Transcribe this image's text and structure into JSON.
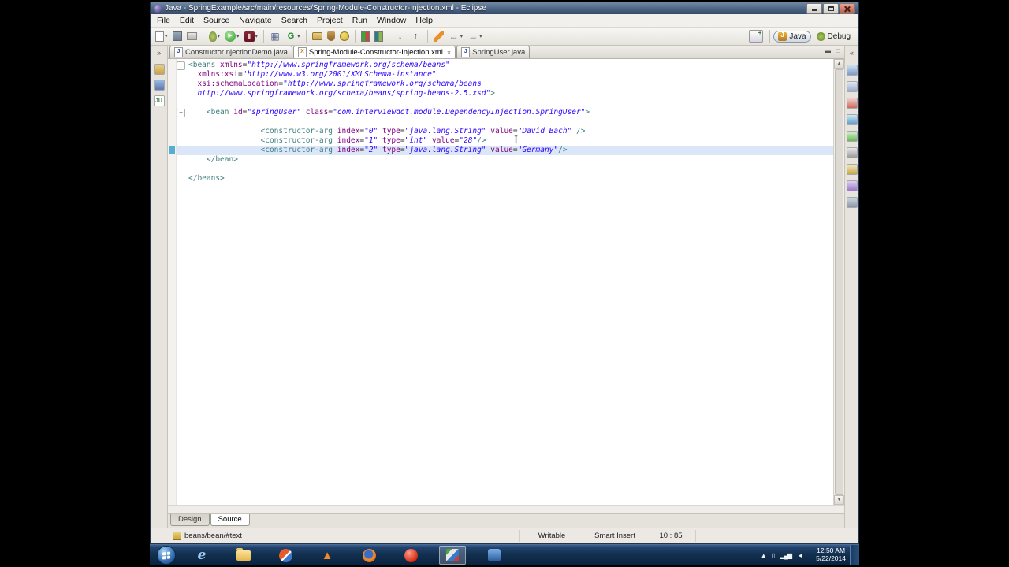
{
  "window": {
    "title": "Java - SpringExample/src/main/resources/Spring-Module-Constructor-Injection.xml - Eclipse",
    "controls": [
      {
        "name": "minimize"
      },
      {
        "name": "maximize"
      },
      {
        "name": "close"
      }
    ]
  },
  "menu": {
    "items": [
      "File",
      "Edit",
      "Source",
      "Navigate",
      "Search",
      "Project",
      "Run",
      "Window",
      "Help"
    ]
  },
  "toolbar": {
    "buttons": [
      {
        "name": "new-wizard",
        "icon": "page",
        "dropdown": true
      },
      {
        "name": "save",
        "icon": "save"
      },
      {
        "name": "print",
        "icon": "print"
      },
      {
        "sep": true
      },
      {
        "name": "debug",
        "icon": "debug",
        "dropdown": true
      },
      {
        "name": "run",
        "icon": "run",
        "dropdown": true
      },
      {
        "name": "coverage",
        "icon": "coverage",
        "dropdown": true
      },
      {
        "sep": true
      },
      {
        "name": "java-ee-table",
        "icon": "grid"
      },
      {
        "name": "run-server",
        "icon": "g",
        "dropdown": true
      },
      {
        "sep": true
      },
      {
        "name": "new-java-project",
        "icon": "project"
      },
      {
        "name": "open-type",
        "icon": "jar"
      },
      {
        "name": "search",
        "icon": "search"
      },
      {
        "sep": true
      },
      {
        "name": "junit",
        "icon": "junit"
      },
      {
        "name": "coverage-report",
        "icon": "junit2"
      },
      {
        "sep": true
      },
      {
        "name": "next-annotation",
        "icon": "down"
      },
      {
        "name": "prev-annotation",
        "icon": "up"
      },
      {
        "sep": true
      },
      {
        "name": "last-edit-location",
        "icon": "edit"
      },
      {
        "name": "back",
        "icon": "back",
        "dropdown": true
      },
      {
        "name": "forward",
        "icon": "forward",
        "dropdown": true
      }
    ]
  },
  "perspectives": {
    "items": [
      {
        "label": "Java",
        "active": true
      },
      {
        "label": "Debug",
        "active": false
      }
    ]
  },
  "editor": {
    "tabs": [
      {
        "label": "ConstructorInjectionDemo.java",
        "kind": "java",
        "active": false
      },
      {
        "label": "Spring-Module-Constructor-Injection.xml",
        "kind": "xml",
        "active": true
      },
      {
        "label": "SpringUser.java",
        "kind": "java",
        "active": false
      }
    ],
    "lines": [
      {
        "n": 1,
        "fold": true,
        "tokens": [
          [
            "t",
            "<beans"
          ],
          [
            "a",
            " xmlns"
          ],
          [
            "e",
            "="
          ],
          [
            "v",
            "\"http://www.springframework.org/schema/beans\""
          ]
        ]
      },
      {
        "n": 2,
        "tokens": [
          [
            "p",
            "  "
          ],
          [
            "a",
            "xmlns:xsi"
          ],
          [
            "e",
            "="
          ],
          [
            "v",
            "\"http://www.w3.org/2001/XMLSchema-instance\""
          ]
        ]
      },
      {
        "n": 3,
        "tokens": [
          [
            "p",
            "  "
          ],
          [
            "a",
            "xsi:schemaLocation"
          ],
          [
            "e",
            "="
          ],
          [
            "v",
            "\"http://www.springframework.org/schema/beans"
          ]
        ]
      },
      {
        "n": 4,
        "tokens": [
          [
            "p",
            "  "
          ],
          [
            "v",
            "http://www.springframework.org/schema/beans/spring-beans-2.5.xsd\""
          ],
          [
            "t",
            ">"
          ]
        ]
      },
      {
        "n": 5,
        "tokens": []
      },
      {
        "n": 6,
        "fold": true,
        "tokens": [
          [
            "p",
            "    "
          ],
          [
            "t",
            "<bean"
          ],
          [
            "a",
            " id"
          ],
          [
            "e",
            "="
          ],
          [
            "v",
            "\"springUser\""
          ],
          [
            "a",
            " class"
          ],
          [
            "e",
            "="
          ],
          [
            "v",
            "\"com.interviewdot.module.DependencyInjection.SpringUser\""
          ],
          [
            "t",
            ">"
          ]
        ]
      },
      {
        "n": 7,
        "tokens": []
      },
      {
        "n": 8,
        "tokens": [
          [
            "p",
            "                "
          ],
          [
            "t",
            "<constructor-arg"
          ],
          [
            "a",
            " index"
          ],
          [
            "e",
            "="
          ],
          [
            "v",
            "\"0\""
          ],
          [
            "a",
            " type"
          ],
          [
            "e",
            "="
          ],
          [
            "v",
            "\"java.lang.String\""
          ],
          [
            "a",
            " value"
          ],
          [
            "e",
            "="
          ],
          [
            "v",
            "\"David Bach\""
          ],
          [
            "t",
            " />"
          ]
        ]
      },
      {
        "n": 9,
        "tokens": [
          [
            "p",
            "                "
          ],
          [
            "t",
            "<constructor-arg"
          ],
          [
            "a",
            " index"
          ],
          [
            "e",
            "="
          ],
          [
            "v",
            "\"1\""
          ],
          [
            "a",
            " type"
          ],
          [
            "e",
            "="
          ],
          [
            "v",
            "\"int\""
          ],
          [
            "a",
            " value"
          ],
          [
            "e",
            "="
          ],
          [
            "v",
            "\"28\""
          ],
          [
            "t",
            "/>"
          ]
        ]
      },
      {
        "n": 10,
        "current": true,
        "tokens": [
          [
            "p",
            "                "
          ],
          [
            "t",
            "<constructor-arg"
          ],
          [
            "a",
            " index"
          ],
          [
            "e",
            "="
          ],
          [
            "v",
            "\"2\""
          ],
          [
            "a",
            " type"
          ],
          [
            "e",
            "="
          ],
          [
            "v",
            "\"java.lang.String\""
          ],
          [
            "a",
            " value"
          ],
          [
            "e",
            "="
          ],
          [
            "v",
            "\"Germany\""
          ],
          [
            "t",
            "/>"
          ]
        ]
      },
      {
        "n": 11,
        "tokens": [
          [
            "p",
            "    "
          ],
          [
            "t",
            "</bean>"
          ]
        ]
      },
      {
        "n": 12,
        "tokens": []
      },
      {
        "n": 13,
        "tokens": [
          [
            "t",
            "</beans>"
          ]
        ]
      }
    ]
  },
  "page_tabs": {
    "items": [
      {
        "label": "Design",
        "active": false
      },
      {
        "label": "Source",
        "active": true
      }
    ]
  },
  "status": {
    "path": "beans/bean/#text",
    "writable": "Writable",
    "mode": "Smart Insert",
    "position": "10 : 85"
  },
  "left_strip": {
    "icons": [
      {
        "name": "restore-views-icon",
        "label": "»"
      },
      {
        "name": "package-explorer-icon"
      },
      {
        "name": "type-hierarchy-icon"
      },
      {
        "name": "junit-view-icon",
        "label": "JU"
      }
    ]
  },
  "right_strip": {
    "icons": [
      {
        "name": "restore-views-icon",
        "label": "«"
      },
      {
        "name": "outline-icon"
      },
      {
        "name": "task-list-icon"
      },
      {
        "name": "problems-icon"
      },
      {
        "name": "javadoc-icon"
      },
      {
        "name": "declaration-icon"
      },
      {
        "name": "console-icon"
      },
      {
        "name": "search-view-icon"
      },
      {
        "name": "history-icon"
      },
      {
        "name": "snippets-icon"
      }
    ]
  },
  "taskbar": {
    "icons": [
      {
        "name": "internet-explorer-icon",
        "glyph": "e"
      },
      {
        "name": "windows-explorer-icon"
      },
      {
        "name": "opera-icon"
      },
      {
        "name": "vlc-icon",
        "glyph": "▲"
      },
      {
        "name": "firefox-icon"
      },
      {
        "name": "app-red-icon"
      },
      {
        "name": "screen-recorder-icon",
        "active": true
      },
      {
        "name": "app-blue-icon"
      }
    ],
    "tray_icons": [
      {
        "name": "show-hidden-icons-icon",
        "glyph": "▲"
      },
      {
        "name": "power-icon",
        "glyph": "▯"
      },
      {
        "name": "network-icon",
        "glyph": "▂▄▆"
      },
      {
        "name": "volume-icon",
        "glyph": "◄"
      }
    ],
    "clock": {
      "time": "12:50 AM",
      "date": "5/22/2014"
    }
  }
}
